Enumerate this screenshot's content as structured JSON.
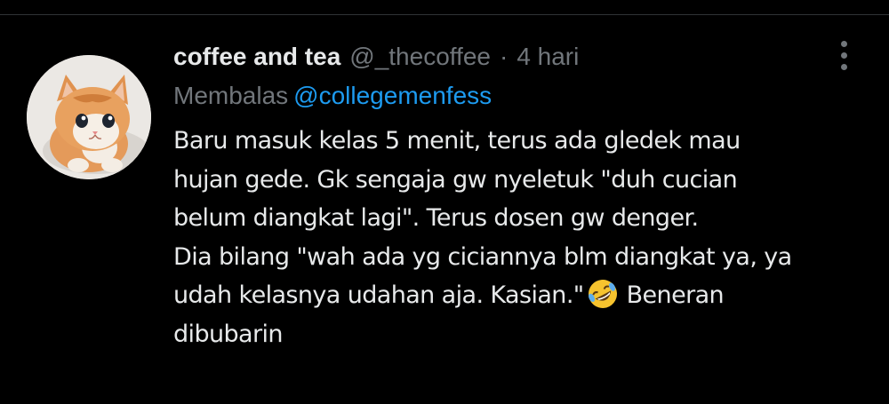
{
  "tweet": {
    "display_name": "coffee and tea",
    "handle": "@_thecoffee",
    "separator": "·",
    "time": "4 hari",
    "reply_prefix": "Membalas",
    "reply_to": "@collegemenfess",
    "body_lines": [
      "Baru masuk kelas 5 menit, terus ada gledek mau",
      "hujan gede. Gk sengaja gw nyeletuk \"duh cucian",
      "belum diangkat lagi\". Terus dosen gw denger.",
      "Dia bilang \"wah ada yg ciciannya blm diangkat ya, ya",
      "udah kelasnya udahan aja. Kasian.\"",
      "Beneran",
      "dibubarin"
    ],
    "emoji": "rolling-on-floor-laughing-emoji",
    "avatar": "kitten-avatar",
    "more_icon": "more-options-icon"
  },
  "colors": {
    "background": "#000000",
    "primary_text": "#e7e9ea",
    "secondary_text": "#71767b",
    "link": "#1d9bf0",
    "divider": "#2f3336"
  }
}
